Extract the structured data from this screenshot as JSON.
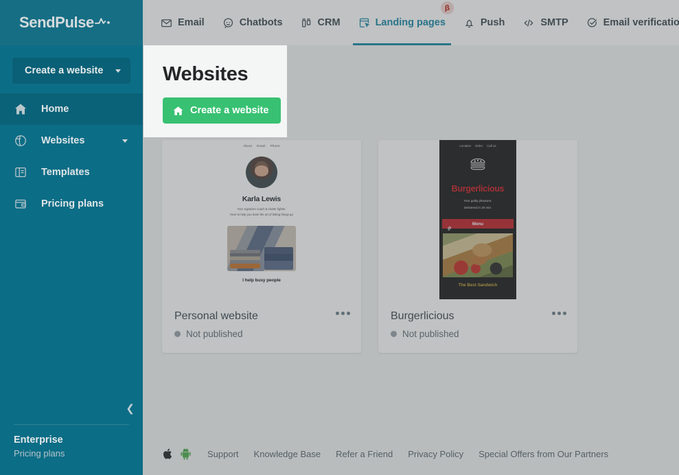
{
  "brand": {
    "name": "SendPulse",
    "mark_icon": "pulse-wave-icon"
  },
  "topnav": {
    "items": [
      {
        "label": "Email",
        "icon": "envelope-icon",
        "active": false,
        "badge": null
      },
      {
        "label": "Chatbots",
        "icon": "chat-bubble-icon",
        "active": false,
        "badge": null
      },
      {
        "label": "CRM",
        "icon": "crm-columns-icon",
        "active": false,
        "badge": null
      },
      {
        "label": "Landing pages",
        "icon": "landing-page-icon",
        "active": true,
        "badge": "β"
      },
      {
        "label": "Push",
        "icon": "bell-icon",
        "active": false,
        "badge": null
      },
      {
        "label": "SMTP",
        "icon": "code-brackets-icon",
        "active": false,
        "badge": null
      },
      {
        "label": "Email verification",
        "icon": "check-circle-icon",
        "active": false,
        "badge": null
      }
    ]
  },
  "sidebar": {
    "create_button": {
      "label": "Create a website",
      "icon": "chevron-down-icon"
    },
    "items": [
      {
        "label": "Home",
        "icon": "home-icon",
        "active": true,
        "caret": false
      },
      {
        "label": "Websites",
        "icon": "globe-icon",
        "active": false,
        "caret": true
      },
      {
        "label": "Templates",
        "icon": "template-icon",
        "active": false,
        "caret": false
      },
      {
        "label": "Pricing plans",
        "icon": "wallet-icon",
        "active": false,
        "caret": false
      }
    ],
    "collapse_icon": "chevron-left-icon",
    "plan": {
      "name": "Enterprise",
      "link": "Pricing plans"
    }
  },
  "main": {
    "title": "Websites",
    "create_button": {
      "label": "Create a website",
      "icon": "home-icon"
    },
    "cards": [
      {
        "title": "Personal website",
        "status": "Not published",
        "status_color": "#9aa4ab",
        "menu_icon": "ellipsis-icon",
        "preview": {
          "kind": "light",
          "nav": [
            "About",
            "Email",
            "Phone"
          ],
          "heading": "Karla Lewis",
          "sub1": "Your organizer coach & clutter fighter.",
          "sub2": "Here to help you learn the art of letting things go",
          "cta": "I help busy people"
        }
      },
      {
        "title": "Burgerlicious",
        "status": "Not published",
        "status_color": "#9aa4ab",
        "menu_icon": "ellipsis-icon",
        "preview": {
          "kind": "dark",
          "nav": [
            "Location",
            "Order",
            "Call us"
          ],
          "logo_icon": "burger-icon",
          "heading": "Burgerlicious",
          "sub1": "Your guilty pleasure.",
          "sub2": "Delivered in 20 min.",
          "button": "Menu",
          "button_icon": "paperclip-icon",
          "cta": "The Best Sandwich"
        }
      }
    ]
  },
  "footer": {
    "icons": [
      {
        "name": "apple-icon"
      },
      {
        "name": "android-icon"
      }
    ],
    "links": [
      "Support",
      "Knowledge Base",
      "Refer a Friend",
      "Privacy Policy",
      "Special Offers from Our Partners"
    ]
  },
  "colors": {
    "sidebar": "#0c6d86",
    "accent": "#1b89a8",
    "green": "#38c172",
    "beta_badge_bg": "#f6d8d6",
    "beta_badge_fg": "#c0392b",
    "burger_red": "#d3242b"
  }
}
